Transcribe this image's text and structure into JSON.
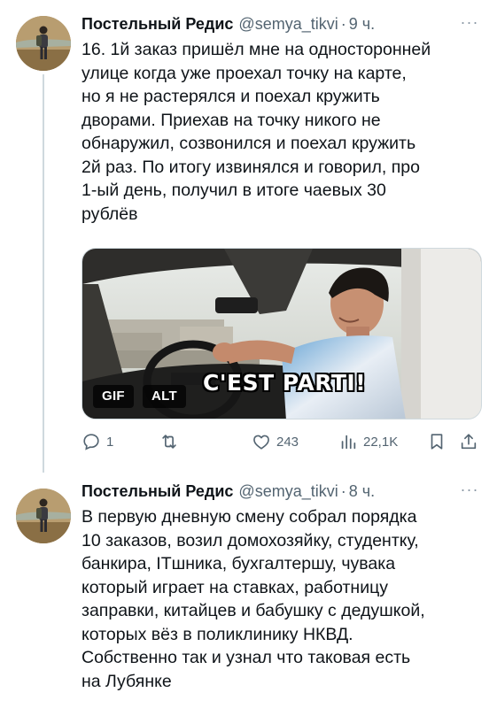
{
  "tweets": [
    {
      "author": {
        "name": "Постельный Редис",
        "handle": "@semya_tikvi",
        "time": "9 ч.",
        "avatar_icon": "avatar-person-icon"
      },
      "separator": "·",
      "more_label": "···",
      "text": "16. 1й заказ пришёл мне на односторонней\nулице когда уже проехал точку на карте,\nно я не растерялся и поехал кружить\nдворами. Приехав на точку никого не\nобнаружил, созвонился и поехал кружить\n2й раз. По итогу  извинялся и говорил, про\n1-ый день, получил в итоге чаевых 30\nрублёв",
      "media": {
        "type": "gif",
        "gif_badge": "GIF",
        "alt_badge": "ALT",
        "caption": "C'EST PARTI!"
      },
      "actions": {
        "reply": "1",
        "retweet": "",
        "like": "243",
        "views": "22,1K"
      }
    },
    {
      "author": {
        "name": "Постельный Редис",
        "handle": "@semya_tikvi",
        "time": "8 ч.",
        "avatar_icon": "avatar-person-icon"
      },
      "separator": "·",
      "more_label": "···",
      "text": "В первую дневную смену собрал порядка\n10 заказов, возил домохозяйку, студентку,\nбанкира, ITшника, бухгалтершу, чувака\nкоторый играет на ставках, работницу\nзаправки, китайцев и бабушку с дедушкой,\nкоторых вёз в поликлинику НКВД.\nСобственно так и узнал что таковая есть\nна Лубянке"
    }
  ],
  "colors": {
    "text_primary": "#0f1419",
    "text_secondary": "#536471",
    "thread_line": "#cfd9de"
  }
}
